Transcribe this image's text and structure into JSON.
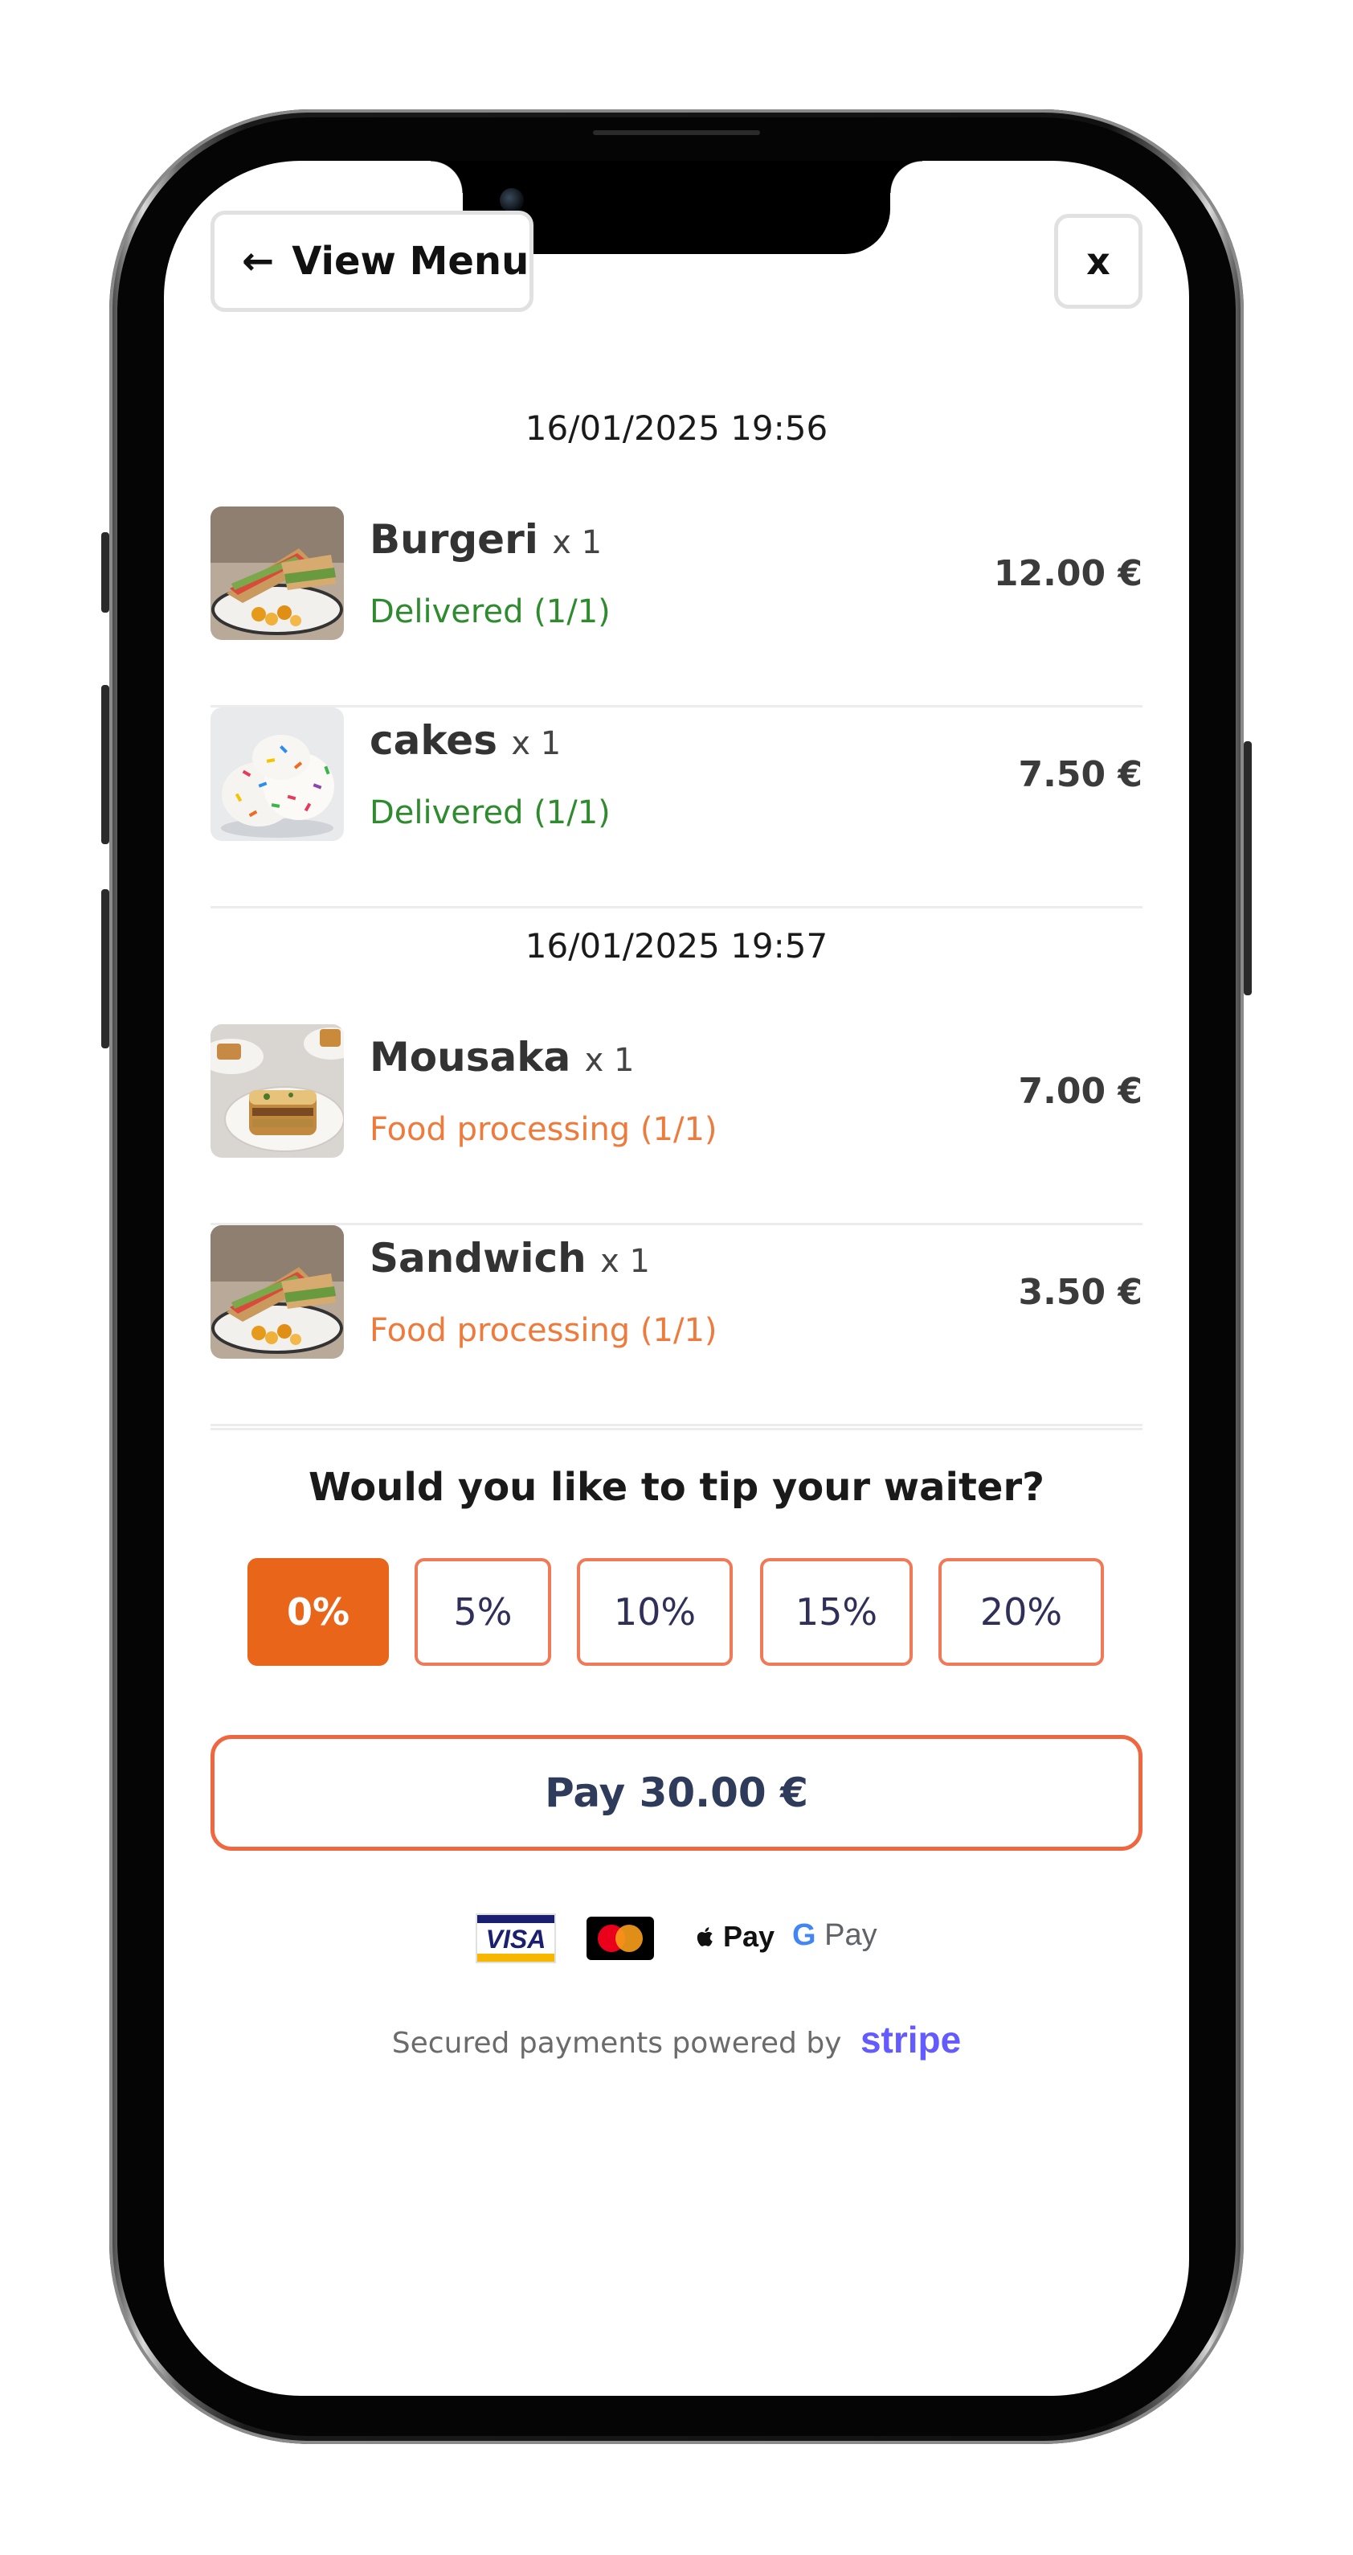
{
  "header": {
    "back_arrow": "←",
    "back_label": "View Menu",
    "close_label": "x"
  },
  "orders": [
    {
      "timestamp": "16/01/2025 19:56",
      "items": [
        {
          "name": "Burgeri",
          "qty": "x 1",
          "status": "Delivered (1/1)",
          "status_type": "delivered",
          "price": "12.00 €",
          "image": "sandwich-plate-photo"
        },
        {
          "name": "cakes",
          "qty": "x 1",
          "status": "Delivered (1/1)",
          "status_type": "delivered",
          "price": "7.50 €",
          "image": "sprinkle-ice-cream-photo"
        }
      ]
    },
    {
      "timestamp": "16/01/2025 19:57",
      "items": [
        {
          "name": "Mousaka",
          "qty": "x 1",
          "status": "Food processing (1/1)",
          "status_type": "processing",
          "price": "7.00 €",
          "image": "mousaka-plates-photo"
        },
        {
          "name": "Sandwich",
          "qty": "x 1",
          "status": "Food processing (1/1)",
          "status_type": "processing",
          "price": "3.50 €",
          "image": "sandwich-plate-photo"
        }
      ]
    }
  ],
  "tip": {
    "title": "Would you like to tip your waiter?",
    "options": [
      "0%",
      "5%",
      "10%",
      "15%",
      "20%"
    ],
    "selected": "0%"
  },
  "payment": {
    "pay_label": "Pay 30.00 €",
    "badges": {
      "visa": "VISA",
      "apple_pay": "Pay",
      "google_pay_g": "G",
      "google_pay_text": "Pay"
    },
    "secured_text": "Secured payments powered by",
    "stripe": "stripe"
  },
  "colors": {
    "accent": "#e8651a",
    "delivered": "#2e8b2e",
    "processing": "#ee7a3c",
    "pay_border": "#f0663f",
    "stripe": "#635bff"
  }
}
